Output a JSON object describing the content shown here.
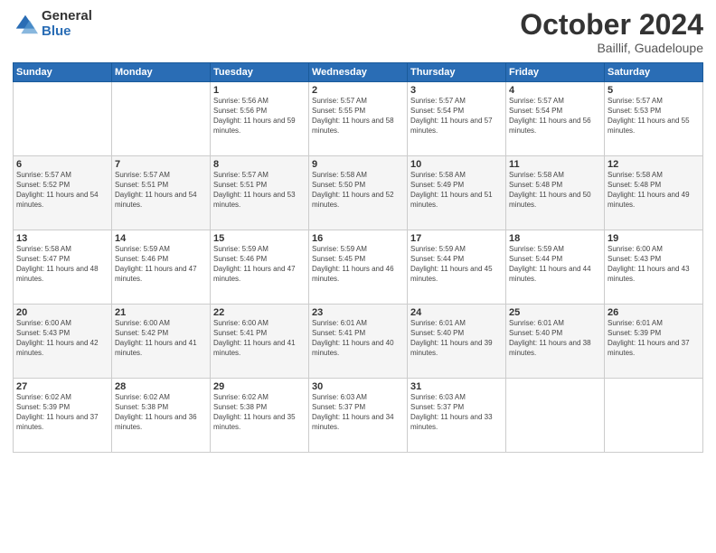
{
  "header": {
    "logo_general": "General",
    "logo_blue": "Blue",
    "month_title": "October 2024",
    "subtitle": "Baillif, Guadeloupe"
  },
  "weekdays": [
    "Sunday",
    "Monday",
    "Tuesday",
    "Wednesday",
    "Thursday",
    "Friday",
    "Saturday"
  ],
  "weeks": [
    [
      {
        "day": "",
        "info": ""
      },
      {
        "day": "",
        "info": ""
      },
      {
        "day": "1",
        "info": "Sunrise: 5:56 AM\nSunset: 5:56 PM\nDaylight: 11 hours and 59 minutes."
      },
      {
        "day": "2",
        "info": "Sunrise: 5:57 AM\nSunset: 5:55 PM\nDaylight: 11 hours and 58 minutes."
      },
      {
        "day": "3",
        "info": "Sunrise: 5:57 AM\nSunset: 5:54 PM\nDaylight: 11 hours and 57 minutes."
      },
      {
        "day": "4",
        "info": "Sunrise: 5:57 AM\nSunset: 5:54 PM\nDaylight: 11 hours and 56 minutes."
      },
      {
        "day": "5",
        "info": "Sunrise: 5:57 AM\nSunset: 5:53 PM\nDaylight: 11 hours and 55 minutes."
      }
    ],
    [
      {
        "day": "6",
        "info": "Sunrise: 5:57 AM\nSunset: 5:52 PM\nDaylight: 11 hours and 54 minutes."
      },
      {
        "day": "7",
        "info": "Sunrise: 5:57 AM\nSunset: 5:51 PM\nDaylight: 11 hours and 54 minutes."
      },
      {
        "day": "8",
        "info": "Sunrise: 5:57 AM\nSunset: 5:51 PM\nDaylight: 11 hours and 53 minutes."
      },
      {
        "day": "9",
        "info": "Sunrise: 5:58 AM\nSunset: 5:50 PM\nDaylight: 11 hours and 52 minutes."
      },
      {
        "day": "10",
        "info": "Sunrise: 5:58 AM\nSunset: 5:49 PM\nDaylight: 11 hours and 51 minutes."
      },
      {
        "day": "11",
        "info": "Sunrise: 5:58 AM\nSunset: 5:48 PM\nDaylight: 11 hours and 50 minutes."
      },
      {
        "day": "12",
        "info": "Sunrise: 5:58 AM\nSunset: 5:48 PM\nDaylight: 11 hours and 49 minutes."
      }
    ],
    [
      {
        "day": "13",
        "info": "Sunrise: 5:58 AM\nSunset: 5:47 PM\nDaylight: 11 hours and 48 minutes."
      },
      {
        "day": "14",
        "info": "Sunrise: 5:59 AM\nSunset: 5:46 PM\nDaylight: 11 hours and 47 minutes."
      },
      {
        "day": "15",
        "info": "Sunrise: 5:59 AM\nSunset: 5:46 PM\nDaylight: 11 hours and 47 minutes."
      },
      {
        "day": "16",
        "info": "Sunrise: 5:59 AM\nSunset: 5:45 PM\nDaylight: 11 hours and 46 minutes."
      },
      {
        "day": "17",
        "info": "Sunrise: 5:59 AM\nSunset: 5:44 PM\nDaylight: 11 hours and 45 minutes."
      },
      {
        "day": "18",
        "info": "Sunrise: 5:59 AM\nSunset: 5:44 PM\nDaylight: 11 hours and 44 minutes."
      },
      {
        "day": "19",
        "info": "Sunrise: 6:00 AM\nSunset: 5:43 PM\nDaylight: 11 hours and 43 minutes."
      }
    ],
    [
      {
        "day": "20",
        "info": "Sunrise: 6:00 AM\nSunset: 5:43 PM\nDaylight: 11 hours and 42 minutes."
      },
      {
        "day": "21",
        "info": "Sunrise: 6:00 AM\nSunset: 5:42 PM\nDaylight: 11 hours and 41 minutes."
      },
      {
        "day": "22",
        "info": "Sunrise: 6:00 AM\nSunset: 5:41 PM\nDaylight: 11 hours and 41 minutes."
      },
      {
        "day": "23",
        "info": "Sunrise: 6:01 AM\nSunset: 5:41 PM\nDaylight: 11 hours and 40 minutes."
      },
      {
        "day": "24",
        "info": "Sunrise: 6:01 AM\nSunset: 5:40 PM\nDaylight: 11 hours and 39 minutes."
      },
      {
        "day": "25",
        "info": "Sunrise: 6:01 AM\nSunset: 5:40 PM\nDaylight: 11 hours and 38 minutes."
      },
      {
        "day": "26",
        "info": "Sunrise: 6:01 AM\nSunset: 5:39 PM\nDaylight: 11 hours and 37 minutes."
      }
    ],
    [
      {
        "day": "27",
        "info": "Sunrise: 6:02 AM\nSunset: 5:39 PM\nDaylight: 11 hours and 37 minutes."
      },
      {
        "day": "28",
        "info": "Sunrise: 6:02 AM\nSunset: 5:38 PM\nDaylight: 11 hours and 36 minutes."
      },
      {
        "day": "29",
        "info": "Sunrise: 6:02 AM\nSunset: 5:38 PM\nDaylight: 11 hours and 35 minutes."
      },
      {
        "day": "30",
        "info": "Sunrise: 6:03 AM\nSunset: 5:37 PM\nDaylight: 11 hours and 34 minutes."
      },
      {
        "day": "31",
        "info": "Sunrise: 6:03 AM\nSunset: 5:37 PM\nDaylight: 11 hours and 33 minutes."
      },
      {
        "day": "",
        "info": ""
      },
      {
        "day": "",
        "info": ""
      }
    ]
  ]
}
